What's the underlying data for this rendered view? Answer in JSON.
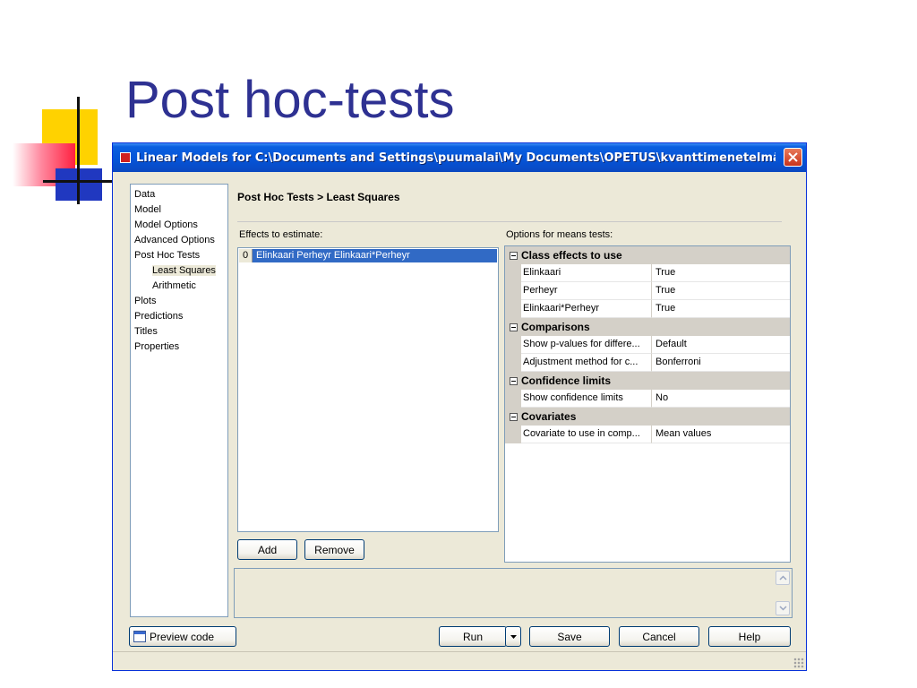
{
  "slide": {
    "title": "Post hoc-tests"
  },
  "window": {
    "title": "Linear Models for C:\\Documents and Settings\\puumalai\\My Documents\\OPETUS\\kvanttimenetelmät\\luennot...",
    "close_glyph": "✕"
  },
  "nav": {
    "items": [
      "Data",
      "Model",
      "Model Options",
      "Advanced Options",
      "Post Hoc Tests"
    ],
    "children": [
      "Least Squares",
      "Arithmetic"
    ],
    "items_after": [
      "Plots",
      "Predictions",
      "Titles",
      "Properties"
    ]
  },
  "section": {
    "title": "Post Hoc Tests > Least Squares"
  },
  "effects": {
    "label": "Effects to estimate:",
    "rows": [
      {
        "index": "0",
        "text": "Elinkaari Perheyr Elinkaari*Perheyr"
      }
    ],
    "add_label": "Add",
    "remove_label": "Remove"
  },
  "options": {
    "label": "Options for means tests:",
    "categories": [
      {
        "name": "Class effects to use",
        "rows": [
          {
            "name": "Elinkaari",
            "value": "True"
          },
          {
            "name": "Perheyr",
            "value": "True"
          },
          {
            "name": "Elinkaari*Perheyr",
            "value": "True"
          }
        ]
      },
      {
        "name": "Comparisons",
        "rows": [
          {
            "name": "Show p-values for differe...",
            "value": "Default"
          },
          {
            "name": "Adjustment method for c...",
            "value": "Bonferroni"
          }
        ]
      },
      {
        "name": "Confidence limits",
        "rows": [
          {
            "name": "Show confidence limits",
            "value": "No"
          }
        ]
      },
      {
        "name": "Covariates",
        "rows": [
          {
            "name": "Covariate to use in comp...",
            "value": "Mean values"
          }
        ]
      }
    ]
  },
  "footer": {
    "preview_label": "Preview code",
    "run_label": "Run",
    "save_label": "Save",
    "cancel_label": "Cancel",
    "help_label": "Help"
  },
  "colors": {
    "title_blue": "#2e3192",
    "selection": "#316ac5",
    "titlebar": "#0553d6"
  }
}
